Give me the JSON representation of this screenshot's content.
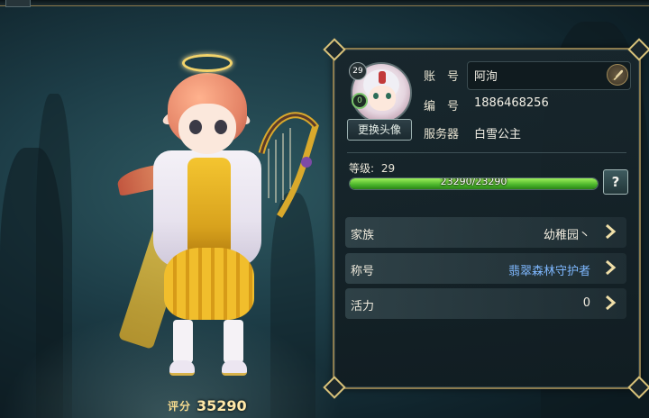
{
  "profile": {
    "level_badge": "29",
    "vip_badge": "0",
    "change_avatar_label": "更换头像",
    "account_label": "账　号",
    "account_value": "阿洵",
    "id_label": "编　号",
    "id_value": "1886468256",
    "server_label": "服务器",
    "server_value": "白雪公主",
    "level_label": "等级:",
    "level_value": "29",
    "exp_text": "23290/23290",
    "exp_fraction": 1.0,
    "help_label": "?"
  },
  "rows": [
    {
      "label": "家族",
      "value": "幼稚园丶",
      "value_color": "#f1ecdf"
    },
    {
      "label": "称号",
      "value": "翡翠森林守护者",
      "value_color": "#7fb8ff"
    },
    {
      "label": "活力",
      "value": "0",
      "value_color": "#f1ecdf"
    }
  ],
  "score": {
    "label": "评分",
    "value": "35290"
  },
  "icons": {
    "edit": "feather-pen-icon",
    "arrow": "chevron-right-icon"
  },
  "colors": {
    "panel_border": "#8b7b4e",
    "exp_fill": "#49b42a",
    "title_blue": "#7fb8ff"
  }
}
